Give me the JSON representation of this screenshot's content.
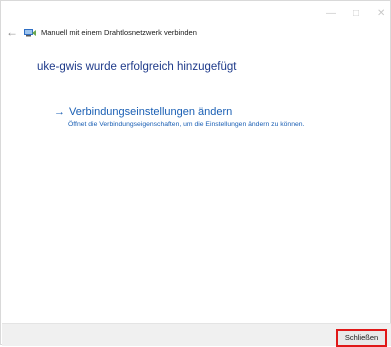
{
  "window": {
    "controls": {
      "minimize": "—",
      "maximize": "□",
      "close": "✕"
    },
    "back_glyph": "←",
    "title": "Manuell mit einem Drahtlosnetzwerk verbinden"
  },
  "main": {
    "heading": "uke-gwis wurde erfolgreich hinzugefügt",
    "link": {
      "arrow": "→",
      "label": "Verbindungseinstellungen ändern",
      "description": "Öffnet die Verbindungseigenschaften, um die Einstellungen ändern zu können."
    }
  },
  "footer": {
    "close_label": "Schließen"
  },
  "colors": {
    "heading": "#1e3a8a",
    "link": "#1a5fb4",
    "close_highlight": "#e01818"
  }
}
